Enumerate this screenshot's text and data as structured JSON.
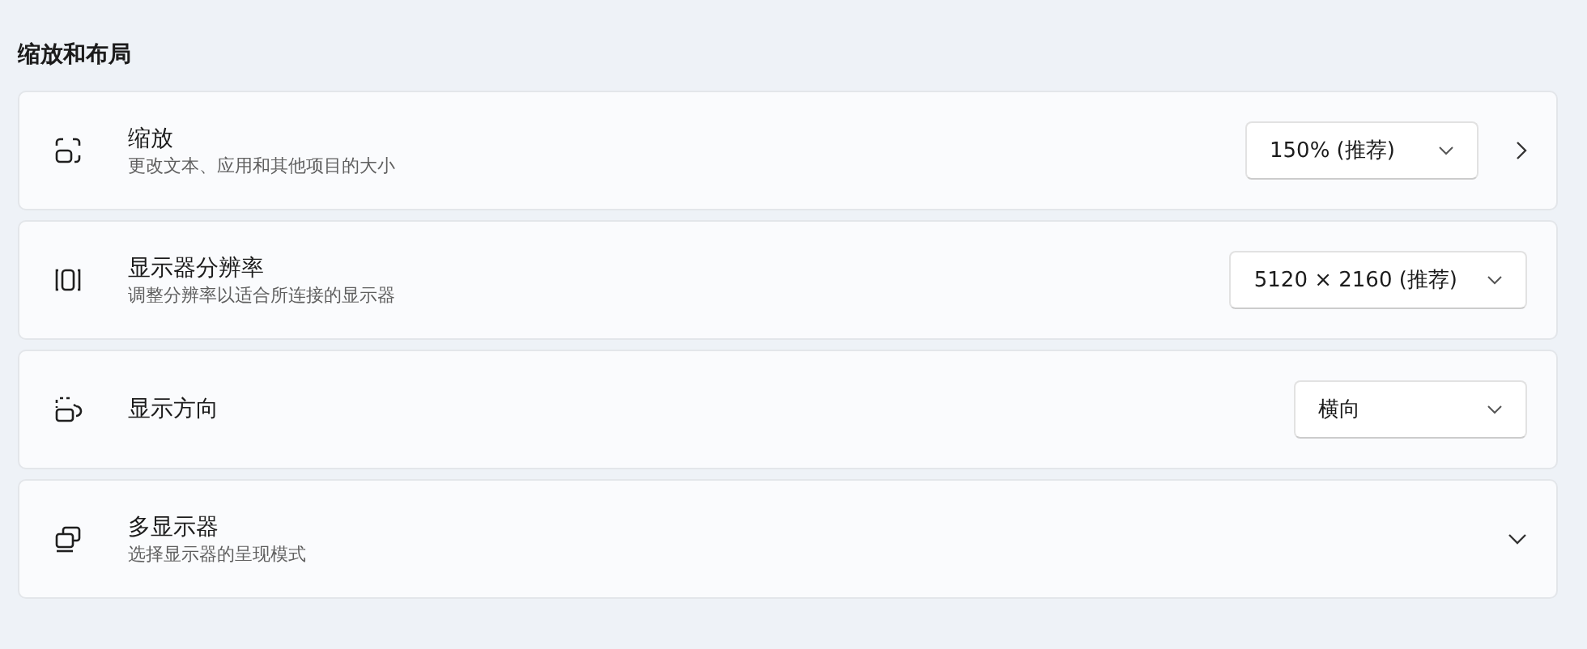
{
  "section_title": "缩放和布局",
  "rows": [
    {
      "title": "缩放",
      "subtitle": "更改文本、应用和其他项目的大小",
      "dropdown": "150% (推荐)",
      "opens_page": true,
      "expandable": false
    },
    {
      "title": "显示器分辨率",
      "subtitle": "调整分辨率以适合所连接的显示器",
      "dropdown": "5120 × 2160 (推荐)",
      "opens_page": false,
      "expandable": false
    },
    {
      "title": "显示方向",
      "dropdown": "横向",
      "opens_page": false,
      "expandable": false
    },
    {
      "title": "多显示器",
      "subtitle": "选择显示器的呈现模式",
      "opens_page": false,
      "expandable": true
    }
  ]
}
